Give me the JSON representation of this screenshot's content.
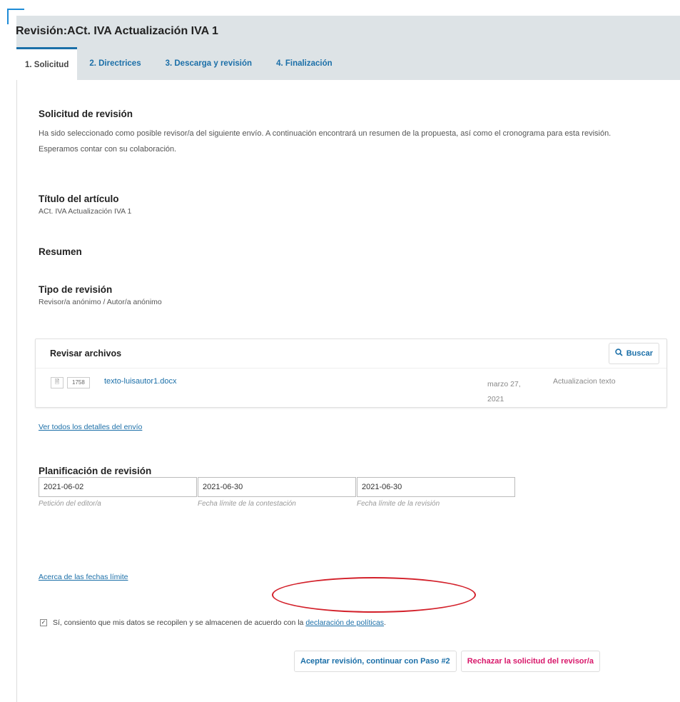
{
  "header": {
    "title": "Revisión:ACt. IVA Actualización IVA 1"
  },
  "tabs": [
    {
      "label": "1. Solicitud"
    },
    {
      "label": "2. Directrices"
    },
    {
      "label": "3. Descarga y revisión"
    },
    {
      "label": "4. Finalización"
    }
  ],
  "request": {
    "heading": "Solicitud de revisión",
    "text": "Ha sido seleccionado como posible revisor/a del siguiente envío. A continuación encontrará un resumen de la propuesta, así como el cronograma para esta revisión. Esperamos contar con su colaboración."
  },
  "article": {
    "heading": "Título del artículo",
    "value": "ACt. IVA Actualización IVA 1"
  },
  "abstract": {
    "heading": "Resumen"
  },
  "review_type": {
    "heading": "Tipo de revisión",
    "value": "Revisor/a anónimo / Autor/a anónimo"
  },
  "files": {
    "heading": "Revisar archivos",
    "search_label": "Buscar",
    "rows": [
      {
        "id": "1758",
        "name": "texto-luisautor1.docx",
        "date": "marzo 27, 2021",
        "description": "Actualizacion texto"
      }
    ]
  },
  "view_details_link": "Ver todos los detalles del envío",
  "schedule": {
    "heading": "Planificación de revisión",
    "fields": [
      {
        "value": "2021-06-02",
        "label": "Petición del editor/a"
      },
      {
        "value": "2021-06-30",
        "label": "Fecha límite de la contestación"
      },
      {
        "value": "2021-06-30",
        "label": "Fecha límite de la revisión"
      }
    ]
  },
  "deadlines_link": "Acerca de las fechas límite",
  "consent": {
    "checked": true,
    "text": "Sí, consiento que mis datos se recopilen y se almacenen de acuerdo con la",
    "link": "declaración de políticas",
    "suffix": "."
  },
  "actions": {
    "accept": "Aceptar revisión, continuar con Paso #2",
    "decline": "Rechazar la solicitud del revisor/a"
  },
  "colors": {
    "accent": "#1b6fa8",
    "danger": "#d8176a",
    "highlight_circle": "#d3202a",
    "header_bg": "#dde3e6"
  }
}
